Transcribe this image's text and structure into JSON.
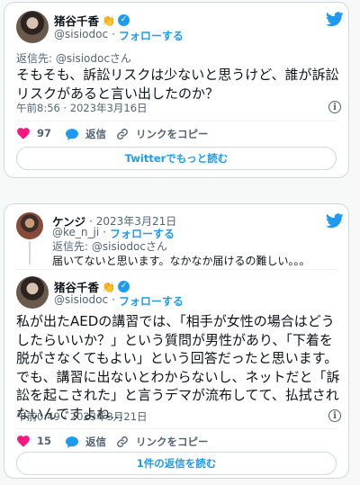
{
  "colors": {
    "accent": "#1d9bf0",
    "heart": "#f91880",
    "text": "#0f1419",
    "muted": "#536471"
  },
  "tweet1": {
    "author": {
      "name": "猪谷千香",
      "emoji": "👏",
      "handle": "@sisiodoc",
      "follow": "フォローする"
    },
    "reply_to": "返信先: @sisiodocさん",
    "text": "そもそも、訴訟リスクは少ないと思うけど、誰が訴訟リスクがあると言い出したのか？",
    "timestamp": "午前8:56 · 2023年3月16日",
    "likes": "97",
    "reply_label": "返信",
    "copy_link_label": "リンクをコピー",
    "read_more": "Twitterでもっと読む"
  },
  "tweet2": {
    "parent": {
      "name": "ケンジ",
      "date": "· 2023年3月21日",
      "handle": "@ke_n_ji",
      "follow": "フォローする",
      "reply_to": "返信先: @sisiodocさん",
      "text": "届いてないと思います。なかなか届けるの難しい。。。"
    },
    "author": {
      "name": "猪谷千香",
      "emoji": "👏",
      "handle": "@sisiodoc",
      "follow": "フォローする"
    },
    "text": "私が出たAEDの講習では、「相手が女性の場合はどうしたらいいか？」という質問が男性があり、「下着を脱がさなくてもよい」という回答だったと思います。でも、講習に出ないとわからないし、ネットだと「訴訟を起こされた」と言うデマが流布してて、払拭されないんですよね…",
    "timestamp": "午前0:49 · 2023年3月21日",
    "likes": "15",
    "reply_label": "返信",
    "copy_link_label": "リンクをコピー",
    "read_replies": "1件の返信を読む"
  }
}
